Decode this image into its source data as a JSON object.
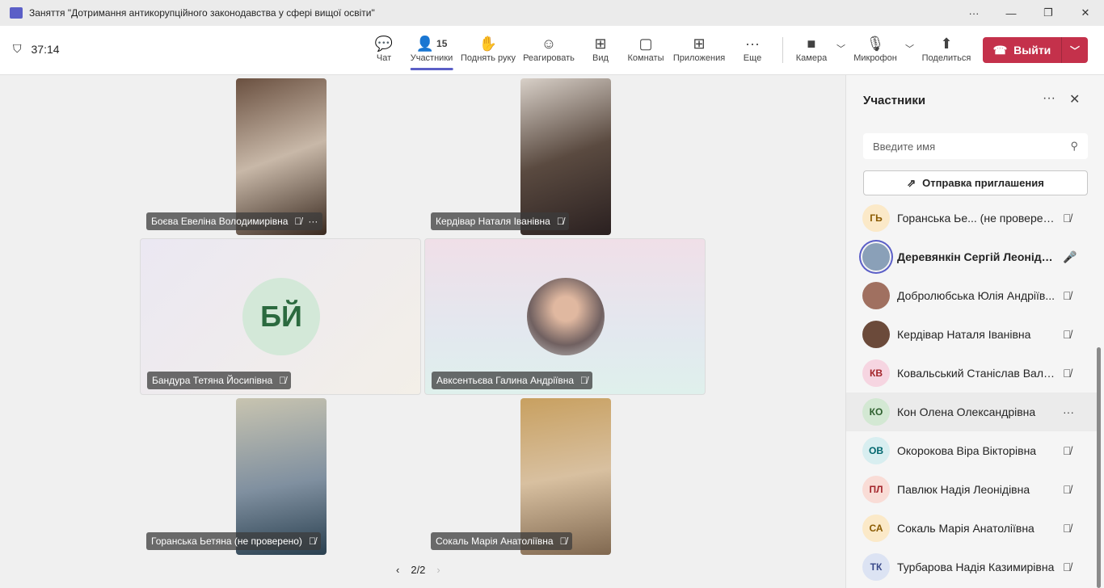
{
  "window": {
    "title": "Заняття \"Дотримання антикорупційного законодавства у сфері вищої освіти\"",
    "more": "···",
    "minimize": "—",
    "restore": "❐",
    "close": "✕"
  },
  "toolbar": {
    "timer": "37:14",
    "participants_count": "15",
    "buttons": [
      {
        "label": "Чат",
        "icon": "chat-icon",
        "glyph": "💬"
      },
      {
        "label": "Участники",
        "icon": "people-icon",
        "glyph": "👤"
      },
      {
        "label": "Поднять руку",
        "icon": "hand-icon",
        "glyph": "✋"
      },
      {
        "label": "Реагировать",
        "icon": "smile-icon",
        "glyph": "☺"
      },
      {
        "label": "Вид",
        "icon": "grid-icon",
        "glyph": "⊞"
      },
      {
        "label": "Комнаты",
        "icon": "rooms-icon",
        "glyph": "▢"
      },
      {
        "label": "Приложения",
        "icon": "plus-icon",
        "glyph": "⊞"
      },
      {
        "label": "Еще",
        "icon": "more-icon",
        "glyph": "···"
      },
      {
        "label": "Камера",
        "icon": "camera-icon",
        "glyph": "■"
      },
      {
        "label": "Микрофон",
        "icon": "mic-icon",
        "glyph": "🎙"
      },
      {
        "label": "Поделиться",
        "icon": "share-icon",
        "glyph": "⬆"
      }
    ],
    "leave_label": "Выйти"
  },
  "stage": {
    "tiles": [
      {
        "name": "Боєва Евеліна Володимирівна",
        "type": "video",
        "more": "···"
      },
      {
        "name": "Кердівар Наталя Іванівна",
        "type": "video"
      },
      {
        "name": "Бандура Тетяна Йосипівна",
        "type": "initials",
        "initials": "БЙ"
      },
      {
        "name": "Авксентьєва Галина Андріївна",
        "type": "photo"
      },
      {
        "name": "Горанська Ьетяна (не проверено)",
        "type": "video"
      },
      {
        "name": "Сокаль Марія Анатоліївна",
        "type": "video"
      }
    ],
    "pager": "2/2"
  },
  "panel": {
    "title": "Участники",
    "more": "···",
    "close": "✕",
    "search_placeholder": "Введите имя",
    "invite_label": "Отправка приглашения",
    "participants": [
      {
        "initials": "ГЬ",
        "name": "Горанська Ье... (не проверено)",
        "mic": "muted",
        "bg": "#fbe9c8",
        "fg": "#8a5a00"
      },
      {
        "initials": "",
        "name": "Деревянкін Сергій Леонідов...",
        "mic": "on",
        "bg": "#8aa0b8",
        "fg": "#fff",
        "bold": true
      },
      {
        "initials": "",
        "name": "Добролюбська Юлія Андріїв...",
        "mic": "muted",
        "bg": "#a07060",
        "fg": "#fff"
      },
      {
        "initials": "",
        "name": "Кердівар Наталя Іванівна",
        "mic": "muted",
        "bg": "#6b4a3a",
        "fg": "#fff"
      },
      {
        "initials": "КВ",
        "name": "Ковальський Станіслав Вале...",
        "mic": "muted",
        "bg": "#f6d5e1",
        "fg": "#a4262c"
      },
      {
        "initials": "КО",
        "name": "Кон Олена Олександрівна",
        "mic": "more",
        "bg": "#d3e8d3",
        "fg": "#2e5f2e"
      },
      {
        "initials": "ОВ",
        "name": "Окорокова Віра Вікторівна",
        "mic": "muted",
        "bg": "#d8eef0",
        "fg": "#00666d"
      },
      {
        "initials": "ПЛ",
        "name": "Павлюк Надія Леонідівна",
        "mic": "muted",
        "bg": "#f9dcd6",
        "fg": "#a4262c"
      },
      {
        "initials": "СА",
        "name": "Сокаль Марія Анатоліївна",
        "mic": "muted",
        "bg": "#fbe9c8",
        "fg": "#8a5a00"
      },
      {
        "initials": "ТК",
        "name": "Турбарова Надія Казимирівна",
        "mic": "muted",
        "bg": "#dce3f3",
        "fg": "#3a4a8a"
      }
    ]
  },
  "colors": {
    "accent": "#5b5fc7",
    "leave": "#c4314b"
  }
}
